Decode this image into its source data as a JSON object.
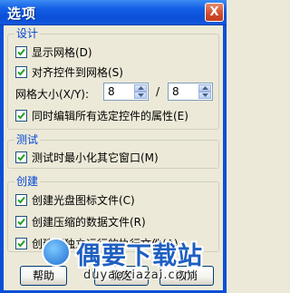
{
  "window": {
    "title": "选项",
    "close_label": "X"
  },
  "groups": {
    "design": {
      "title": "设计",
      "show_grid": {
        "label": "显示网格(D)",
        "checked": true
      },
      "snap_to_grid": {
        "label": "对齐控件到网格(S)",
        "checked": true
      },
      "grid_size": {
        "label": "网格大小(X/Y):",
        "x_value": "8",
        "separator": "/",
        "y_value": "8"
      },
      "edit_all": {
        "label": "同时编辑所有选定控件的属性(E)",
        "checked": true
      }
    },
    "test": {
      "title": "测试",
      "minimize": {
        "label": "测试时最小化其它窗口(M)",
        "checked": true
      }
    },
    "create": {
      "title": "创建",
      "create_iso": {
        "label": "创建光盘图标文件(C)",
        "checked": true
      },
      "create_compressed": {
        "label": "创建压缩的数据文件(R)",
        "checked": true
      },
      "standalone": {
        "label": "创建可独立运行的执行文件(A)",
        "checked": true
      }
    }
  },
  "buttons": {
    "help": "帮助",
    "ok": "确定",
    "cancel": "取消"
  },
  "watermark": {
    "brand": "偶要下载站",
    "url": "duyaoxiazai.com"
  }
}
